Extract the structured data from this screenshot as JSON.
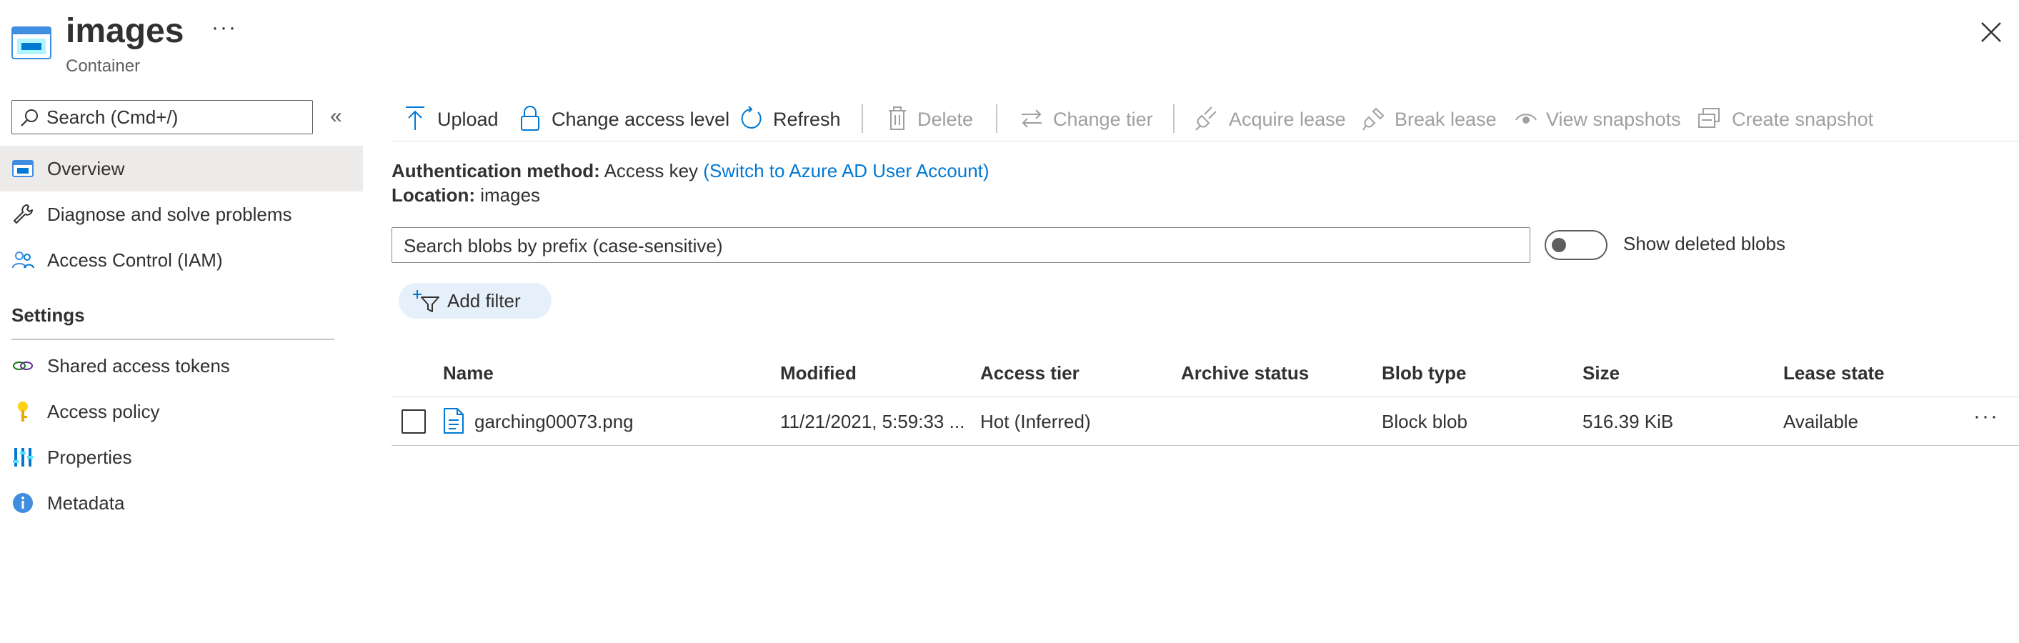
{
  "header": {
    "title": "images",
    "subtitle": "Container",
    "more_label": "···",
    "icons": {
      "container": "storage-container-icon",
      "close": "close-icon"
    }
  },
  "sidebar": {
    "search_placeholder": "Search (Cmd+/)",
    "collapse_label": "«",
    "items": [
      {
        "label": "Overview",
        "icon": "overview-icon",
        "selected": true
      },
      {
        "label": "Diagnose and solve problems",
        "icon": "wrench-icon"
      },
      {
        "label": "Access Control (IAM)",
        "icon": "people-icon"
      }
    ],
    "settings_title": "Settings",
    "settings_items": [
      {
        "label": "Shared access tokens",
        "icon": "link-icon"
      },
      {
        "label": "Access policy",
        "icon": "key-icon"
      },
      {
        "label": "Properties",
        "icon": "properties-icon"
      },
      {
        "label": "Metadata",
        "icon": "info-icon"
      }
    ]
  },
  "toolbar": {
    "upload": "Upload",
    "change_access_level": "Change access level",
    "refresh": "Refresh",
    "delete": "Delete",
    "change_tier": "Change tier",
    "acquire_lease": "Acquire lease",
    "break_lease": "Break lease",
    "view_snapshots": "View snapshots",
    "create_snapshot": "Create snapshot"
  },
  "info": {
    "auth_label": "Authentication method:",
    "auth_value": "Access key",
    "auth_link": "(Switch to Azure AD User Account)",
    "location_label": "Location:",
    "location_value": "images"
  },
  "blob_search": {
    "placeholder": "Search blobs by prefix (case-sensitive)"
  },
  "show_deleted": {
    "label": "Show deleted blobs",
    "on": false
  },
  "filter": {
    "label": "Add filter"
  },
  "table": {
    "columns": [
      "Name",
      "Modified",
      "Access tier",
      "Archive status",
      "Blob type",
      "Size",
      "Lease state"
    ],
    "rows": [
      {
        "name": "garching00073.png",
        "modified": "11/21/2021, 5:59:33 ...",
        "access_tier": "Hot (Inferred)",
        "archive_status": "",
        "blob_type": "Block blob",
        "size": "516.39 KiB",
        "lease_state": "Available",
        "more_label": "···"
      }
    ]
  },
  "colors": {
    "accent": "#0078d4",
    "selected_bg": "#edebe9",
    "disabled_text": "#a19f9d",
    "filter_pill_bg": "#e6f0fb"
  }
}
